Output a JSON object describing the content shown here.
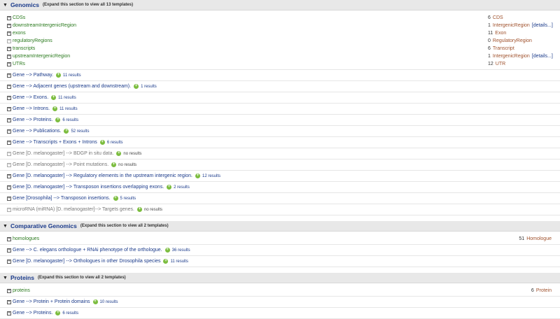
{
  "sections": [
    {
      "title": "Genomics",
      "note": "(Expand this section to view all 13 templates)",
      "collections": [
        {
          "name": "CDSs",
          "count": "6",
          "type": "CDS",
          "details": ""
        },
        {
          "name": "downstreamIntergenicRegion",
          "count": "1",
          "type": "IntergenicRegion",
          "details": "[details...]"
        },
        {
          "name": "exons",
          "count": "11",
          "type": "Exon",
          "details": ""
        },
        {
          "name": "regulatoryRegions",
          "count": "0",
          "type": "RegulatoryRegion",
          "details": "",
          "disabled": true
        },
        {
          "name": "transcripts",
          "count": "6",
          "type": "Transcript",
          "details": ""
        },
        {
          "name": "upstreamIntergenicRegion",
          "count": "1",
          "type": "IntergenicRegion",
          "details": "[details...]"
        },
        {
          "name": "UTRs",
          "count": "12",
          "type": "UTR",
          "details": ""
        }
      ],
      "templates": [
        {
          "name": "Gene --> Pathway.",
          "results": "11 results"
        },
        {
          "name": "Gene --> Adjacent genes (upstream and downstream).",
          "results": "1 results"
        },
        {
          "name": "Gene --> Exons.",
          "results": "11 results"
        },
        {
          "name": "Gene --> Introns.",
          "results": "11 results"
        },
        {
          "name": "Gene --> Proteins.",
          "results": "6 results"
        },
        {
          "name": "Gene --> Publications.",
          "results": "52 results"
        },
        {
          "name": "Gene --> Transcripts + Exons + Introns",
          "results": "6 results"
        },
        {
          "name": "Gene [D. melanogaster] --> BDGP in situ data.",
          "results": "no results",
          "disabled": true
        },
        {
          "name": "Gene [D. melanogaster] --> Point mutations.",
          "results": "no results",
          "disabled": true
        },
        {
          "name": "Gene [D. melanogaster] --> Regulatory elements in the upstream intergenic region.",
          "results": "12 results"
        },
        {
          "name": "Gene [D. melanogaster] --> Transposon insertions overlapping exons.",
          "results": "2 results"
        },
        {
          "name": "Gene [Drosophila] --> Transposon insertions.",
          "results": "5 results"
        },
        {
          "name": "microRNA (miRNA) [D. melanogaster]--> Targets genes.",
          "results": "no results",
          "disabled": true
        }
      ]
    },
    {
      "title": "Comparative Genomics",
      "note": "(Expand this section to view all 2 templates)",
      "collections": [
        {
          "name": "homologues",
          "count": "51",
          "type": "Homologue",
          "details": "",
          "right": true
        }
      ],
      "templates": [
        {
          "name": "Gene --> C. elegans orthologue + RNAi phenotype of the orthologue.",
          "results": "36 results"
        },
        {
          "name": "Gene [D. melanogaster] --> Orthologues in other Drosophila species",
          "results": "11 results"
        }
      ]
    },
    {
      "title": "Proteins",
      "note": "(Expand this section to view all 2 templates)",
      "collections": [
        {
          "name": "proteins",
          "count": "6",
          "type": "Protein",
          "details": "",
          "right": true
        }
      ],
      "templates": [
        {
          "name": "Gene --> Protein + Protein domains",
          "results": "10 results"
        },
        {
          "name": "Gene --> Proteins.",
          "results": "6 results"
        }
      ]
    }
  ],
  "icons": {
    "expand": "expand-box-icon",
    "run": "run-template-icon",
    "triangle": "collapse-triangle-icon"
  }
}
